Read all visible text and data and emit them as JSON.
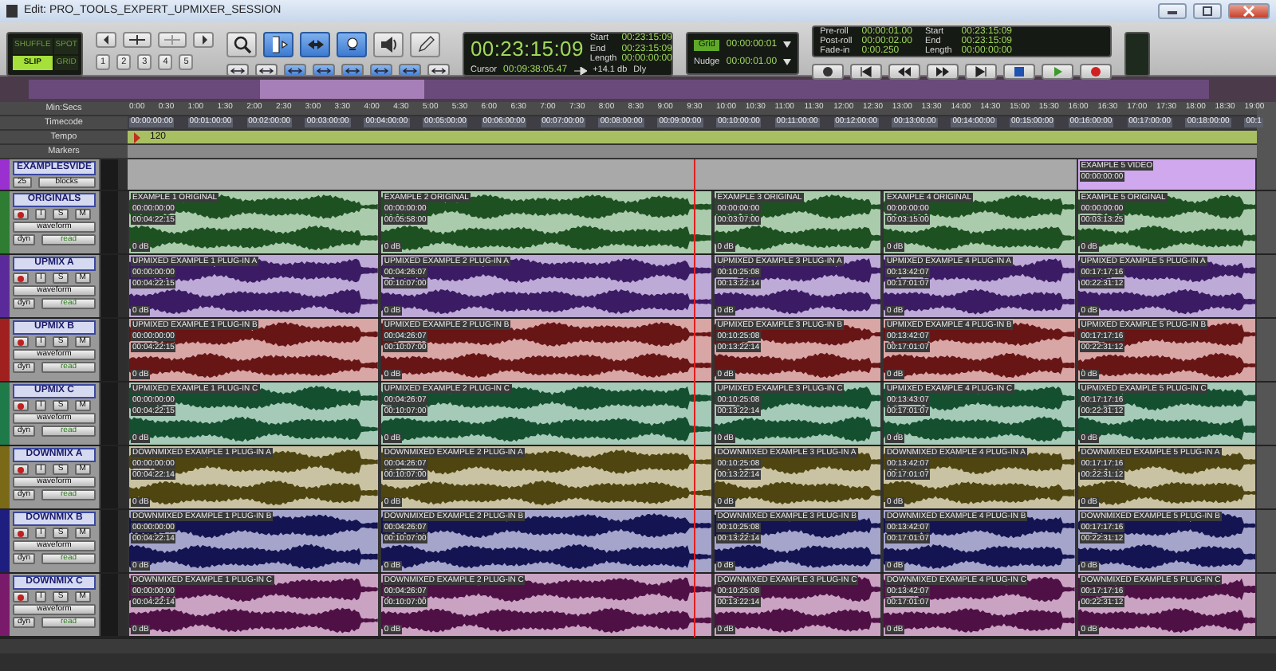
{
  "window": {
    "title": "Edit: PRO_TOOLS_EXPERT_UPMIXER_SESSION"
  },
  "edit_modes": [
    {
      "label": "SHUFFLE",
      "selected": false
    },
    {
      "label": "SPOT",
      "selected": false
    },
    {
      "label": "SLIP",
      "selected": true
    },
    {
      "label": "GRID",
      "selected": false
    }
  ],
  "zoom_presets": [
    "1",
    "2",
    "3",
    "4",
    "5"
  ],
  "tools": [
    {
      "kind": "zoom",
      "selected": false
    },
    {
      "kind": "trim",
      "selected": true
    },
    {
      "kind": "grabber",
      "selected": true
    },
    {
      "kind": "scrub",
      "selected": true
    },
    {
      "kind": "speaker",
      "selected": false
    },
    {
      "kind": "pencil",
      "selected": false
    }
  ],
  "counter": {
    "main": "00:23:15:09",
    "fields": [
      {
        "label": "Start",
        "value": "00:23:15:09"
      },
      {
        "label": "End",
        "value": "00:23:15:09"
      },
      {
        "label": "Length",
        "value": "00:00:00:00"
      }
    ],
    "cursor_label": "Cursor",
    "cursor": "00:09:38:05.47",
    "level": "+14.1 db",
    "dly": "Dly"
  },
  "grid": {
    "label": "Grid",
    "value": "00:00:00:01"
  },
  "nudge": {
    "label": "Nudge",
    "value": "00:00:01.00"
  },
  "transport_fields": [
    {
      "label": "Pre-roll",
      "value": "00:00:01.00"
    },
    {
      "label": "Post-roll",
      "value": "00:00:02.00"
    },
    {
      "label": "Fade-in",
      "value": "0:00.250"
    }
  ],
  "selection_fields": [
    {
      "label": "Start",
      "value": "00:23:15:09"
    },
    {
      "label": "End",
      "value": "00:23:15:09"
    },
    {
      "label": "Length",
      "value": "00:00:00:00"
    }
  ],
  "transport": [
    {
      "kind": "online"
    },
    {
      "kind": "start"
    },
    {
      "kind": "rewind"
    },
    {
      "kind": "forward"
    },
    {
      "kind": "end"
    },
    {
      "kind": "stop"
    },
    {
      "kind": "play"
    },
    {
      "kind": "record"
    }
  ],
  "rulers": {
    "labels": [
      "Min:Secs",
      "Timecode",
      "Tempo",
      "Markers"
    ],
    "minsecs": [
      "0:00",
      "0:30",
      "1:00",
      "1:30",
      "2:00",
      "2:30",
      "3:00",
      "3:30",
      "4:00",
      "4:30",
      "5:00",
      "5:30",
      "6:00",
      "6:30",
      "7:00",
      "7:30",
      "8:00",
      "8:30",
      "9:00",
      "9:30",
      "10:00",
      "10:30",
      "11:00",
      "11:30",
      "12:00",
      "12:30",
      "13:00",
      "13:30",
      "14:00",
      "14:30",
      "15:00",
      "15:30",
      "16:00",
      "16:30",
      "17:00",
      "17:30",
      "18:00",
      "18:30",
      "19:00"
    ],
    "timecode": [
      "00:00:00:00",
      "00:01:00:00",
      "00:02:00:00",
      "00:03:00:00",
      "00:04:00:00",
      "00:05:00:00",
      "00:06:00:00",
      "00:07:00:00",
      "00:08:00:00",
      "00:09:00:00",
      "00:10:00:00",
      "00:11:00:00",
      "00:12:00:00",
      "00:13:00:00",
      "00:14:00:00",
      "00:15:00:00",
      "00:16:00:00",
      "00:17:00:00",
      "00:18:00:00",
      "00:1"
    ],
    "tempo": "120"
  },
  "video_track": {
    "name": "EXAMPLESVIDE",
    "frames": "25",
    "view": "blocks",
    "clip": {
      "name": "EXAMPLE 5 VIDEO",
      "start": "00:00:00:00"
    }
  },
  "tracks": [
    {
      "name": "ORIGINALS",
      "color": "#2e7d32",
      "buttons": [
        "I",
        "S",
        "M"
      ],
      "view": "waveform",
      "dyn": "dyn",
      "mode": "read",
      "clips": [
        {
          "name": "EXAMPLE 1 ORIGINAL",
          "start": "00:00:00:00",
          "end": "00:04:22:15",
          "gain": "0 dB"
        },
        {
          "name": "EXAMPLE 2 ORIGINAL",
          "start": "00:00:00:00",
          "end": "00:05:58:00",
          "gain": "0 dB"
        },
        {
          "name": "EXAMPLE 3 ORIGINAL",
          "start": "00:00:00:00",
          "end": "00:03:07:00",
          "gain": "0 dB"
        },
        {
          "name": "EXAMPLE 4 ORIGINAL",
          "start": "00:00:00:00",
          "end": "00:03:15:00",
          "gain": "0 dB"
        },
        {
          "name": "EXAMPLE 5 ORIGINAL",
          "start": "00:00:00:00",
          "end": "00:03:13:25",
          "gain": "0 dB"
        }
      ]
    },
    {
      "name": "UPMIX A",
      "color": "#5b2a9a",
      "buttons": [
        "I",
        "S",
        "M"
      ],
      "view": "waveform",
      "dyn": "dyn",
      "mode": "read",
      "clips": [
        {
          "name": "UPMIXED EXAMPLE 1 PLUG-IN A",
          "start": "00:00:00:00",
          "end": "00:04:22:15",
          "gain": "0 dB"
        },
        {
          "name": "UPMIXED EXAMPLE 2 PLUG-IN A",
          "start": "00:04:26:07",
          "end": "00:10:07:00",
          "gain": "0 dB"
        },
        {
          "name": "UPMIXED EXAMPLE 3 PLUG-IN A",
          "start": "00:10:25:08",
          "end": "00:13:22:14",
          "gain": "0 dB"
        },
        {
          "name": "UPMIXED EXAMPLE 4 PLUG-IN A",
          "start": "00:13:42:07",
          "end": "00:17:01:07",
          "gain": "0 dB"
        },
        {
          "name": "UPMIXED EXAMPLE 5 PLUG-IN A",
          "start": "00:17:17:16",
          "end": "00:22:31:12",
          "gain": "0 dB"
        }
      ]
    },
    {
      "name": "UPMIX B",
      "color": "#a02020",
      "buttons": [
        "I",
        "S",
        "M"
      ],
      "view": "waveform",
      "dyn": "dyn",
      "mode": "read",
      "clips": [
        {
          "name": "UPMIXED EXAMPLE 1 PLUG-IN B",
          "start": "00:00:00:00",
          "end": "00:04:22:15",
          "gain": "0 dB"
        },
        {
          "name": "UPMIXED EXAMPLE 2 PLUG-IN B",
          "start": "00:04:26:07",
          "end": "00:10:07:00",
          "gain": "0 dB"
        },
        {
          "name": "UPMIXED EXAMPLE 3 PLUG-IN B",
          "start": "00:10:25:08",
          "end": "00:13:22:14",
          "gain": "0 dB"
        },
        {
          "name": "UPMIXED EXAMPLE 4 PLUG-IN B",
          "start": "00:13:42:07",
          "end": "00:17:01:07",
          "gain": "0 dB"
        },
        {
          "name": "UPMIXED EXAMPLE 5 PLUG-IN B",
          "start": "00:17:17:16",
          "end": "00:22:31:12",
          "gain": "0 dB"
        }
      ]
    },
    {
      "name": "UPMIX C",
      "color": "#1f7a4a",
      "buttons": [
        "I",
        "S",
        "M"
      ],
      "view": "waveform",
      "dyn": "dyn",
      "mode": "read",
      "clips": [
        {
          "name": "UPMIXED EXAMPLE 1 PLUG-IN C",
          "start": "00:00:00:00",
          "end": "00:04:22:15",
          "gain": "0 dB"
        },
        {
          "name": "UPMIXED EXAMPLE 2 PLUG-IN C",
          "start": "00:04:26:07",
          "end": "00:10:07:00",
          "gain": "0 dB"
        },
        {
          "name": "UPMIXED EXAMPLE 3 PLUG-IN C",
          "start": "00:10:25:08",
          "end": "00:13:22:14",
          "gain": "0 dB"
        },
        {
          "name": "UPMIXED EXAMPLE 4 PLUG-IN C",
          "start": "00:13:43:07",
          "end": "00:17:01:07",
          "gain": "0 dB"
        },
        {
          "name": "UPMIXED EXAMPLE 5 PLUG-IN C",
          "start": "00:17:17:16",
          "end": "00:22:31:12",
          "gain": "0 dB"
        }
      ]
    },
    {
      "name": "DOWNMIX A",
      "color": "#7a6a18",
      "buttons": [
        "I",
        "S",
        "M"
      ],
      "view": "waveform",
      "dyn": "dyn",
      "mode": "read",
      "clips": [
        {
          "name": "DOWNMIXED EXAMPLE 1 PLUG-IN A",
          "start": "00:00:00:00",
          "end": "00:04:22:14",
          "gain": "0 dB"
        },
        {
          "name": "DOWNMIXED EXAMPLE 2 PLUG-IN A",
          "start": "00:04:26:07",
          "end": "00:10:07:00",
          "gain": "0 dB"
        },
        {
          "name": "DOWNMIXED EXAMPLE 3 PLUG-IN A",
          "start": "00:10:25:08",
          "end": "00:13:22:14",
          "gain": "0 dB"
        },
        {
          "name": "DOWNMIXED EXAMPLE 4 PLUG-IN A",
          "start": "00:13:42:07",
          "end": "00:17:01:07",
          "gain": "0 dB"
        },
        {
          "name": "DOWNMIXED EXAMPLE 5 PLUG-IN A",
          "start": "00:17:17:16",
          "end": "00:22:31:12",
          "gain": "0 dB"
        }
      ]
    },
    {
      "name": "DOWNMIX B",
      "color": "#1e1e80",
      "buttons": [
        "I",
        "S",
        "M"
      ],
      "view": "waveform",
      "dyn": "dyn",
      "mode": "read",
      "clips": [
        {
          "name": "DOWNMIXED EXAMPLE 1 PLUG-IN B",
          "start": "00:00:00:00",
          "end": "00:04:22:14",
          "gain": "0 dB"
        },
        {
          "name": "DOWNMIXED EXAMPLE 2 PLUG-IN B",
          "start": "00:04:26:07",
          "end": "00:10:07:00",
          "gain": "0 dB"
        },
        {
          "name": "DOWNMIXED EXAMPLE 3 PLUG-IN B",
          "start": "00:10:25:08",
          "end": "00:13:22:14",
          "gain": "0 dB"
        },
        {
          "name": "DOWNMIXED EXAMPLE 4 PLUG-IN B",
          "start": "00:13:42:07",
          "end": "00:17:01:07",
          "gain": "0 dB"
        },
        {
          "name": "DOWNMIXED EXAMPLE 5 PLUG-IN B",
          "start": "00:17:17:16",
          "end": "00:22:31:12",
          "gain": "0 dB"
        }
      ]
    },
    {
      "name": "DOWNMIX C",
      "color": "#7a1a6a",
      "buttons": [
        "I",
        "S",
        "M"
      ],
      "view": "waveform",
      "dyn": "dyn",
      "mode": "read",
      "clips": [
        {
          "name": "DOWNMIXED EXAMPLE 1 PLUG-IN C",
          "start": "00:00:00:00",
          "end": "00:04:22:14",
          "gain": "0 dB"
        },
        {
          "name": "DOWNMIXED EXAMPLE 2 PLUG-IN C",
          "start": "00:04:26:07",
          "end": "00:10:07:00",
          "gain": "0 dB"
        },
        {
          "name": "DOWNMIXED EXAMPLE 3 PLUG-IN C",
          "start": "00:10:25:08",
          "end": "00:13:22:14",
          "gain": "0 dB"
        },
        {
          "name": "DOWNMIXED EXAMPLE 4 PLUG-IN C",
          "start": "00:13:42:07",
          "end": "00:17:01:07",
          "gain": "0 dB"
        },
        {
          "name": "DOWNMIXED EXAMPLE 5 PLUG-IN C",
          "start": "00:17:17:16",
          "end": "00:22:31:12",
          "gain": "0 dB"
        }
      ]
    }
  ]
}
